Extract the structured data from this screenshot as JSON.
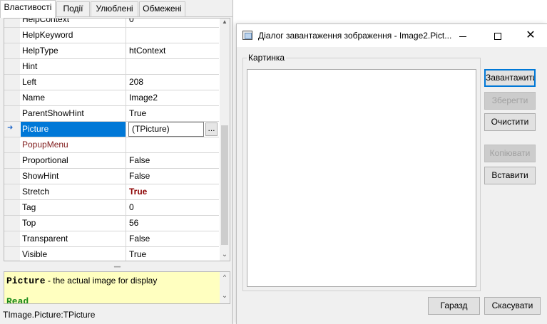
{
  "inspector": {
    "tabs": [
      "Властивості",
      "Події",
      "Улюблені",
      "Обмежені"
    ],
    "properties": [
      {
        "name": "HelpContext",
        "value": "0"
      },
      {
        "name": "HelpKeyword",
        "value": ""
      },
      {
        "name": "HelpType",
        "value": "htContext"
      },
      {
        "name": "Hint",
        "value": ""
      },
      {
        "name": "Left",
        "value": "208"
      },
      {
        "name": "Name",
        "value": "Image2"
      },
      {
        "name": "ParentShowHint",
        "value": "True"
      },
      {
        "name": "Picture",
        "value": "(TPicture)",
        "ellipsis": "..."
      },
      {
        "name": "PopupMenu",
        "value": ""
      },
      {
        "name": "Proportional",
        "value": "False"
      },
      {
        "name": "ShowHint",
        "value": "False"
      },
      {
        "name": "Stretch",
        "value": "True"
      },
      {
        "name": "Tag",
        "value": "0"
      },
      {
        "name": "Top",
        "value": "56"
      },
      {
        "name": "Transparent",
        "value": "False"
      },
      {
        "name": "Visible",
        "value": "True"
      }
    ],
    "selected_property": "Picture",
    "hint": {
      "name": "Picture",
      "text": " - the actual image for display",
      "cut_text": "Read"
    },
    "status": "TImage.Picture:TPicture"
  },
  "dialog": {
    "title": "Діалог завантаження зображення - Image2.Pict...",
    "group_label": "Картинка",
    "buttons": {
      "load": "Завантажити",
      "save": "Зберегти",
      "clear": "Очистити",
      "copy": "Копіювати",
      "paste": "Вставити",
      "ok": "Гаразд",
      "cancel": "Скасувати"
    },
    "window_controls": {
      "minimize": "—",
      "maximize": "□",
      "close": "✕"
    }
  },
  "colors": {
    "selection": "#0078d7",
    "hint_background": "#ffffc0",
    "changed_value": "#8b0000",
    "event_property": "#7f1a1a"
  }
}
